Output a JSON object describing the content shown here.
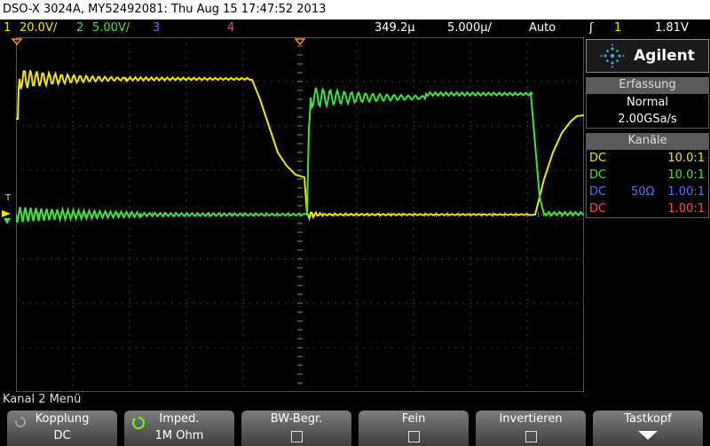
{
  "header": {
    "title": "DSO-X 3024A, MY52492081: Thu Aug 15 17:47:52 2013"
  },
  "status": {
    "ch1_num": "1",
    "ch1_scale": "20.0V/",
    "ch2_num": "2",
    "ch2_scale": "5.00V/",
    "ch3_num": "3",
    "ch4_num": "4",
    "time_delay": "349.2µ",
    "time_scale": "5.000µ/",
    "trigger_mode": "Auto",
    "trigger_symbol": "ʃ",
    "trigger_source": "1",
    "trigger_level": "1.81V"
  },
  "sidebar": {
    "brand": "Agilent",
    "acq_header": "Erfassung",
    "acq_mode": "Normal",
    "acq_rate": "2.00GSa/s",
    "chan_header": "Kanäle",
    "channels": [
      {
        "coupling": "DC",
        "impedance": "",
        "probe": "10.0:1",
        "color": "#f2e600"
      },
      {
        "coupling": "DC",
        "impedance": "",
        "probe": "10.0:1",
        "color": "#3ee23e"
      },
      {
        "coupling": "DC",
        "impedance": "50Ω",
        "probe": "1.00:1",
        "color": "#5a6cff"
      },
      {
        "coupling": "DC",
        "impedance": "",
        "probe": "1.00:1",
        "color": "#ff3c7a"
      }
    ]
  },
  "menu": {
    "title": "Kanal 2 Menü",
    "softkeys": [
      {
        "label": "Kopplung",
        "value": "DC"
      },
      {
        "label": "Imped.",
        "value": "1M Ohm"
      },
      {
        "label": "BW-Begr.",
        "value": ""
      },
      {
        "label": "Fein",
        "value": ""
      },
      {
        "label": "Invertieren",
        "value": ""
      },
      {
        "label": "Tastkopf",
        "value": ""
      }
    ]
  },
  "colors": {
    "ch1": "#f2e600",
    "ch2": "#3ee23e",
    "ch3": "#5a6cff",
    "ch4": "#ff3c7a",
    "trigger_marker": "#ff8c1a"
  }
}
